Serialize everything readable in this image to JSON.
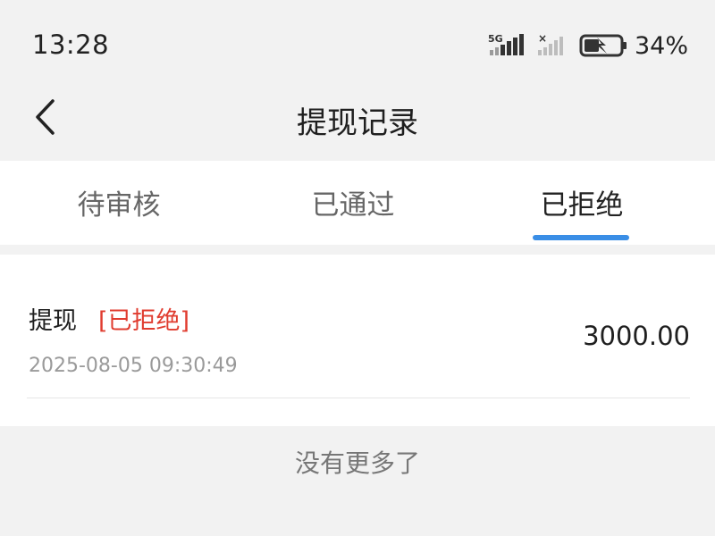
{
  "status_bar": {
    "time": "13:28",
    "signal_label": "5G",
    "battery_percent": "34%",
    "icons": [
      "signal-5g-icon",
      "signal-no-sim-icon",
      "battery-charging-icon"
    ]
  },
  "header": {
    "title": "提现记录",
    "back_icon": "chevron-left-icon"
  },
  "tabs": [
    {
      "label": "待审核",
      "active": false
    },
    {
      "label": "已通过",
      "active": false
    },
    {
      "label": "已拒绝",
      "active": true
    }
  ],
  "colors": {
    "accent": "#3a8ee6",
    "rejected": "#e03c2f",
    "background": "#f2f2f2"
  },
  "records": [
    {
      "title": "提现",
      "status": "[已拒绝]",
      "time": "2025-08-05 09:30:49",
      "amount": "3000.00"
    }
  ],
  "footer": {
    "no_more_text": "没有更多了"
  }
}
